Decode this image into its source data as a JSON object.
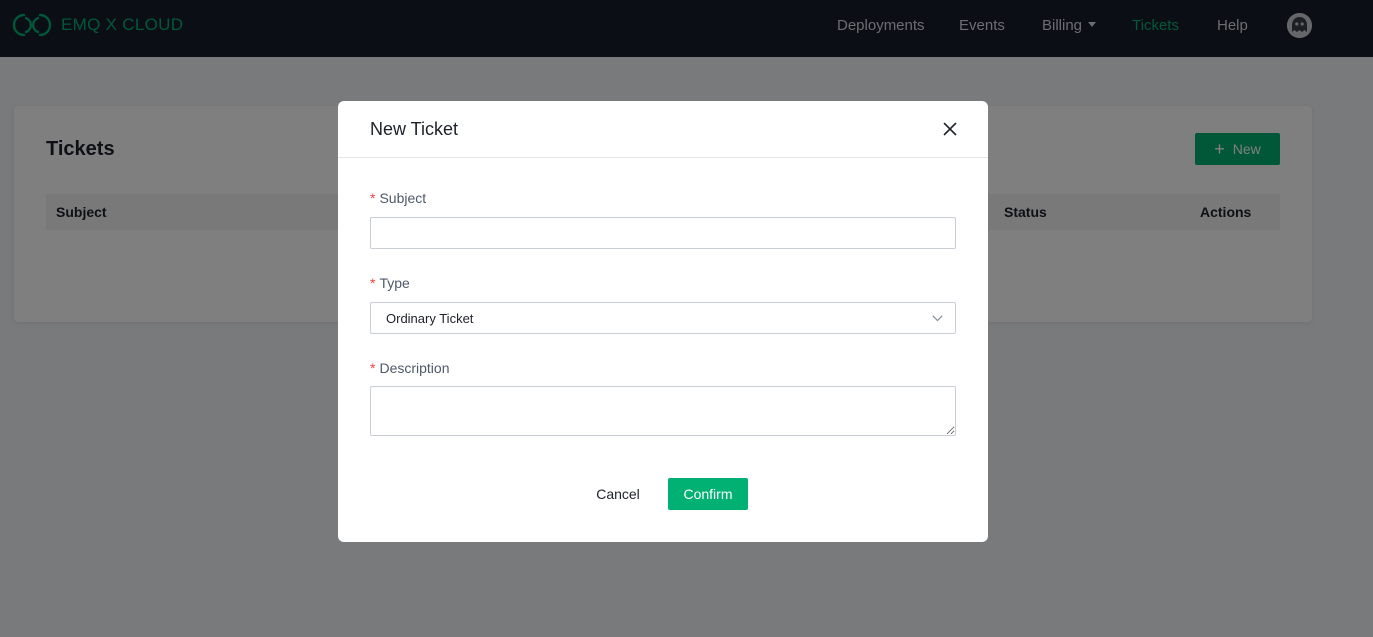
{
  "brand": {
    "name": "EMQ X CLOUD",
    "logo_icon": "emqx-logo-icon",
    "color": "#00b173"
  },
  "nav": {
    "items": [
      {
        "label": "Deployments"
      },
      {
        "label": "Events"
      },
      {
        "label": "Billing",
        "has_dropdown": true
      },
      {
        "label": "Tickets",
        "active": true
      },
      {
        "label": "Help"
      }
    ],
    "avatar_icon": "user-avatar-icon"
  },
  "page": {
    "title": "Tickets",
    "new_button": {
      "icon": "plus-icon",
      "label": "New"
    },
    "table": {
      "columns": [
        "Subject",
        "Status",
        "Actions"
      ]
    }
  },
  "modal": {
    "title": "New Ticket",
    "close_icon": "close-icon",
    "fields": {
      "subject": {
        "label": "Subject",
        "required_mark": "*",
        "value": "",
        "placeholder": ""
      },
      "type": {
        "label": "Type",
        "required_mark": "*",
        "value": "Ordinary Ticket",
        "icon": "chevron-down-icon"
      },
      "description": {
        "label": "Description",
        "required_mark": "*",
        "value": "",
        "placeholder": ""
      }
    },
    "buttons": {
      "cancel": "Cancel",
      "confirm": "Confirm"
    }
  },
  "colors": {
    "accent": "#00b173",
    "topbar": "#171d2b",
    "required": "#f53f3f"
  }
}
